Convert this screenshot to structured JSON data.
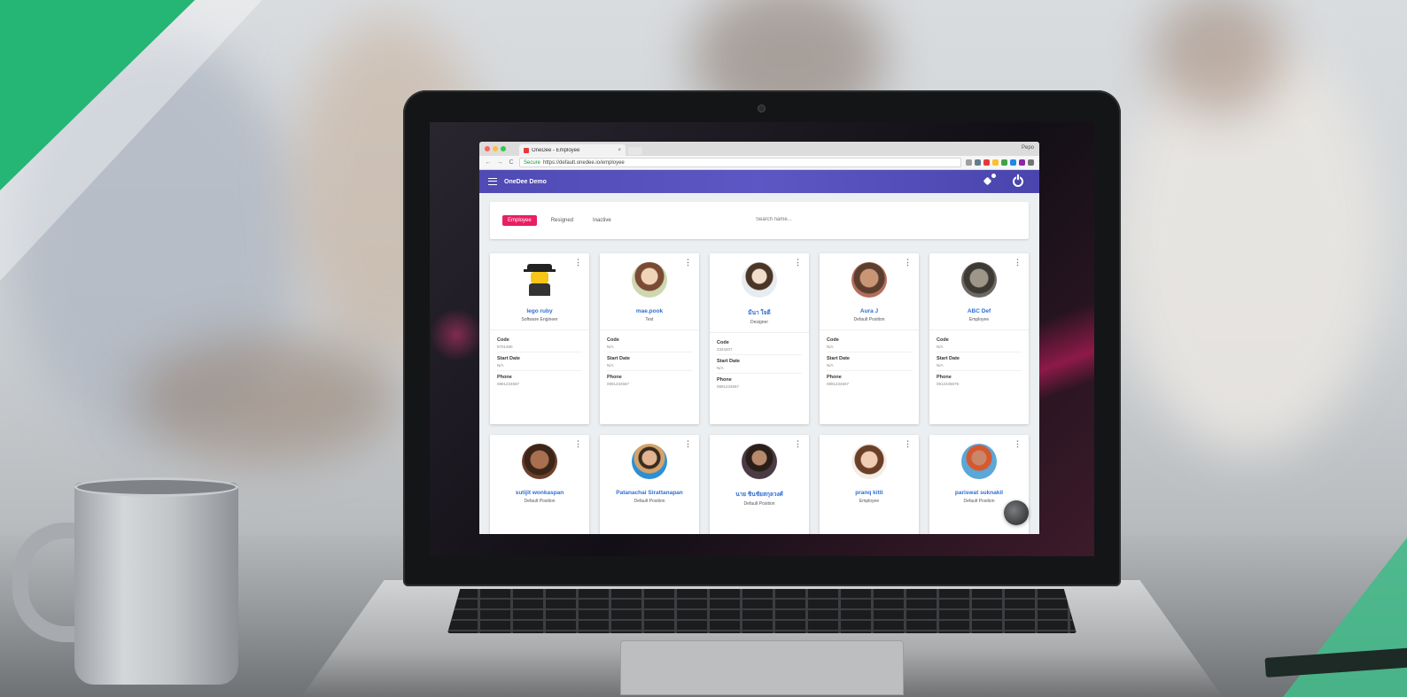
{
  "browser": {
    "tab_title": "OneDee - Employee",
    "tab_close": "×",
    "user_name": "Pepo",
    "url_secure": "Secure",
    "url": "https://default.onedee.io/employee",
    "nav_back": "←",
    "nav_forward": "→",
    "nav_reload": "C"
  },
  "app": {
    "title": "OneDee Demo"
  },
  "filters": {
    "tabs": [
      {
        "label": "Employee"
      },
      {
        "label": "Resigned"
      },
      {
        "label": "Inactive"
      }
    ],
    "search_placeholder": "Search name..."
  },
  "card_labels": {
    "code": "Code",
    "start_date": "Start Date",
    "phone": "Phone",
    "menu": "⋮"
  },
  "employees": [
    {
      "name": "lego ruby",
      "role": "Software Engineer",
      "code": "5701480",
      "start_date": "N/A",
      "phone": "0891234567"
    },
    {
      "name": "mae.pook",
      "role": "Test",
      "code": "N/A",
      "start_date": "N/A",
      "phone": "0891234567"
    },
    {
      "name": "มีนา ใจดี",
      "role": "Designer",
      "code": "2324407",
      "start_date": "N/A",
      "phone": "0891234567"
    },
    {
      "name": "Aura J",
      "role": "Default Position",
      "code": "N/A",
      "start_date": "N/A",
      "phone": "0891234567"
    },
    {
      "name": "ABC Def",
      "role": "Employee",
      "code": "N/A",
      "start_date": "N/A",
      "phone": "0812345678"
    },
    {
      "name": "sutijit wonkaspan",
      "role": "Default Position"
    },
    {
      "name": "Patanachai Sirattanapan",
      "role": "Default Position"
    },
    {
      "name": "นาย ชินชัยสกุลวงศ์",
      "role": "Default Position"
    },
    {
      "name": "pranq kitti",
      "role": "Employee"
    },
    {
      "name": "pariswat suknakil",
      "role": "Default Position"
    }
  ],
  "colors": {
    "appbar": "#4f4ab4",
    "active_chip": "#e91e63",
    "name_link": "#2f6fd1",
    "brand_green": "#25b574"
  }
}
